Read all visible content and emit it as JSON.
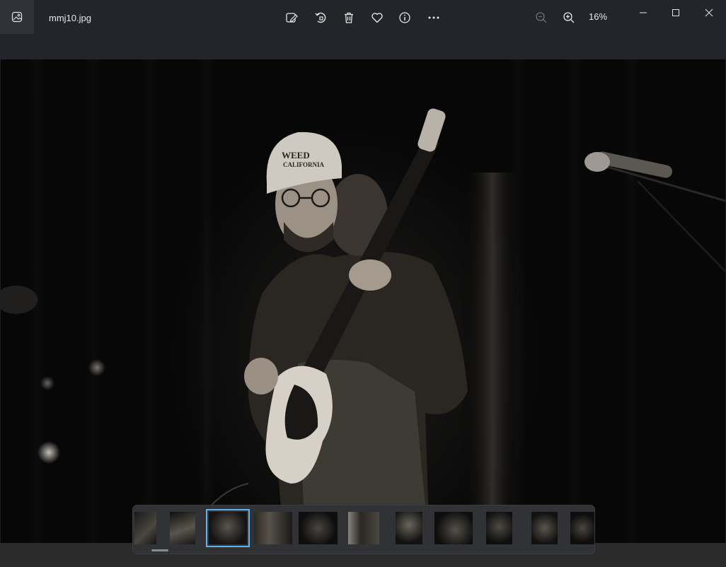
{
  "window": {
    "filename": "mmj10.jpg",
    "zoom": "16%"
  },
  "toolbar": {
    "icons": [
      "edit-image-icon",
      "rotate-icon",
      "delete-icon",
      "favorite-icon",
      "info-icon",
      "more-icon"
    ]
  },
  "zoom_controls": [
    "zoom-out-icon",
    "zoom-in-icon"
  ],
  "window_controls": [
    "minimize-icon",
    "maximize-icon",
    "close-icon"
  ],
  "photo": {
    "cap_text_line1": "WEED",
    "cap_text_line2": "CALIFORNIA"
  },
  "filmstrip": {
    "count": 11,
    "selected_index": 2
  },
  "colors": {
    "accent": "#5db2f0",
    "titlebar": "#22262b",
    "filmstrip_bg": "#303235"
  }
}
